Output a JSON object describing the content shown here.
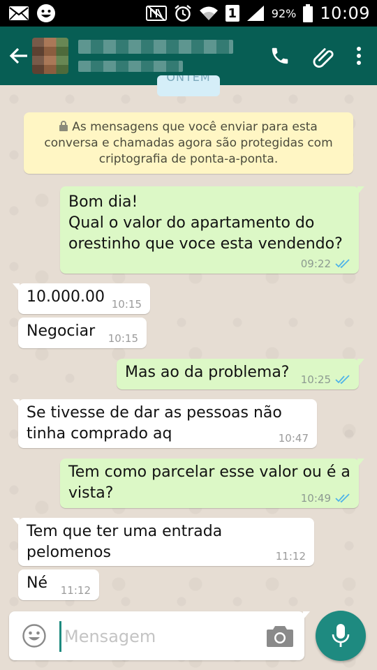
{
  "status_bar": {
    "battery": "92%",
    "time": "10:09",
    "sim_slot": "1"
  },
  "header": {
    "icons": [
      "back-arrow-icon",
      "phone-icon",
      "paperclip-icon",
      "overflow-menu-icon"
    ]
  },
  "chat": {
    "date_chip": "ONTEM",
    "system_message": "As mensagens que você enviar para esta\nconversa e chamadas agora são protegidas com\ncriptografia de ponta-a-ponta.",
    "messages": [
      {
        "direction": "out",
        "text": "Bom dia!\nQual o valor do apartamento do\norestinho que voce esta vendendo?",
        "time": "09:22",
        "status": "read"
      },
      {
        "direction": "in",
        "text": "10.000.00",
        "time": "10:15"
      },
      {
        "direction": "in",
        "text": "Negociar",
        "time": "10:15"
      },
      {
        "direction": "out",
        "text": "Mas  ao da problema?",
        "time": "10:25",
        "status": "read"
      },
      {
        "direction": "in",
        "text": "Se tivesse de dar as pessoas não\ntinha comprado aq",
        "time": "10:47"
      },
      {
        "direction": "out",
        "text": "Tem como parcelar esse valor ou é a\nvista?",
        "time": "10:49",
        "status": "read"
      },
      {
        "direction": "in",
        "text": "Tem que ter uma entrada pelomenos",
        "time": "11:12"
      },
      {
        "direction": "in",
        "text": "Né",
        "time": "11:12"
      }
    ]
  },
  "composer": {
    "placeholder": "Mensagem",
    "icons": [
      "emoji-icon",
      "camera-icon",
      "mic-icon"
    ]
  },
  "colors": {
    "appbar": "#075e54",
    "outgoing_bubble": "#dcf8c6",
    "incoming_bubble": "#ffffff",
    "read_ticks": "#4fb3e8",
    "mic_button": "#1e8a80",
    "system_message_bg": "#fff6c4"
  }
}
